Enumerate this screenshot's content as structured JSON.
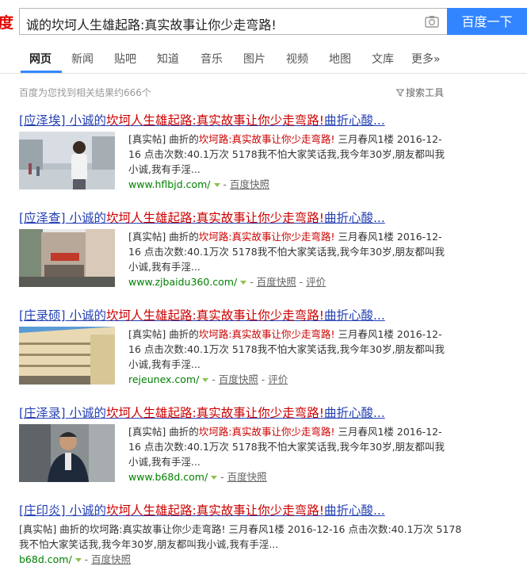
{
  "header": {
    "logo_text": "度",
    "search_value": "诚的坎坷人生雄起路:真实故事让你少走弯路!",
    "search_button": "百度一下"
  },
  "tabs": [
    {
      "label": "网页",
      "active": true
    },
    {
      "label": "新闻"
    },
    {
      "label": "贴吧"
    },
    {
      "label": "知道"
    },
    {
      "label": "音乐"
    },
    {
      "label": "图片"
    },
    {
      "label": "视频"
    },
    {
      "label": "地图"
    },
    {
      "label": "文库"
    },
    {
      "label": "更多»"
    }
  ],
  "info": {
    "result_count": "百度为您找到相关结果约666个",
    "search_tools": "搜索工具"
  },
  "results": [
    {
      "title_prefix": "[应泽埃]",
      "title_mid": " 小诚的",
      "title_hl": "坎坷人生雄起路:真实故事让你少走弯路!",
      "title_suffix": "曲折心酸...",
      "body_pre": "[真实帖] 曲折的",
      "body_hl": "坎坷路:真实故事让你少走弯路!",
      "body_post": " 三月春风1楼 2016-12-16 点击次数:40.1万次 5178我不怕大家笑话我,我今年30岁,朋友都叫我小诚,我有手淫...",
      "url": "www.hflbjd.com/",
      "cache": "百度快照",
      "review": ""
    },
    {
      "title_prefix": "[应泽查]",
      "title_mid": " 小诚的",
      "title_hl": "坎坷人生雄起路:真实故事让你少走弯路!",
      "title_suffix": "曲折心酸...",
      "body_pre": "[真实帖] 曲折的",
      "body_hl": "坎坷路:真实故事让你少走弯路!",
      "body_post": " 三月春风1楼 2016-12-16 点击次数:40.1万次 5178我不怕大家笑话我,我今年30岁,朋友都叫我小诚,我有手淫...",
      "url": "www.zjbaidu360.com/",
      "cache": "百度快照",
      "review": "评价"
    },
    {
      "title_prefix": "[庄录硕]",
      "title_mid": " 小诚的",
      "title_hl": "坎坷人生雄起路:真实故事让你少走弯路!",
      "title_suffix": "曲折心酸...",
      "body_pre": "[真实帖] 曲折的",
      "body_hl": "坎坷路:真实故事让你少走弯路!",
      "body_post": " 三月春风1楼 2016-12-16 点击次数:40.1万次 5178我不怕大家笑话我,我今年30岁,朋友都叫我小诚,我有手淫...",
      "url": "rejeunex.com/",
      "cache": "百度快照",
      "review": "评价"
    },
    {
      "title_prefix": "[庄泽录]",
      "title_mid": " 小诚的",
      "title_hl": "坎坷人生雄起路:真实故事让你少走弯路!",
      "title_suffix": "曲折心酸...",
      "body_pre": "[真实帖] 曲折的",
      "body_hl": "坎坷路:真实故事让你少走弯路!",
      "body_post": " 三月春风1楼 2016-12-16 点击次数:40.1万次 5178我不怕大家笑话我,我今年30岁,朋友都叫我小诚,我有手淫...",
      "url": "www.b68d.com/",
      "cache": "百度快照",
      "review": ""
    },
    {
      "title_prefix": "[庄印炎]",
      "title_mid": " 小诚的",
      "title_hl": "坎坷人生雄起路:真实故事让你少走弯路!",
      "title_suffix": "曲折心酸...",
      "body_pre": "[真实帖] 曲折的",
      "body_hl": "坎坷路:真实故事让你少走弯路!",
      "body_post": " 三月春风1楼 2016-12-16 点击次数:40.1万次 5178我不怕大家笑话我,我今年30岁,朋友都叫我小诚,我有手淫...",
      "url": "b68d.com/",
      "cache": "百度快照",
      "review": ""
    }
  ],
  "colors": {
    "accent": "#3385ff",
    "title_link": "#2440b3",
    "highlight": "#cc0000",
    "url": "#008000"
  }
}
